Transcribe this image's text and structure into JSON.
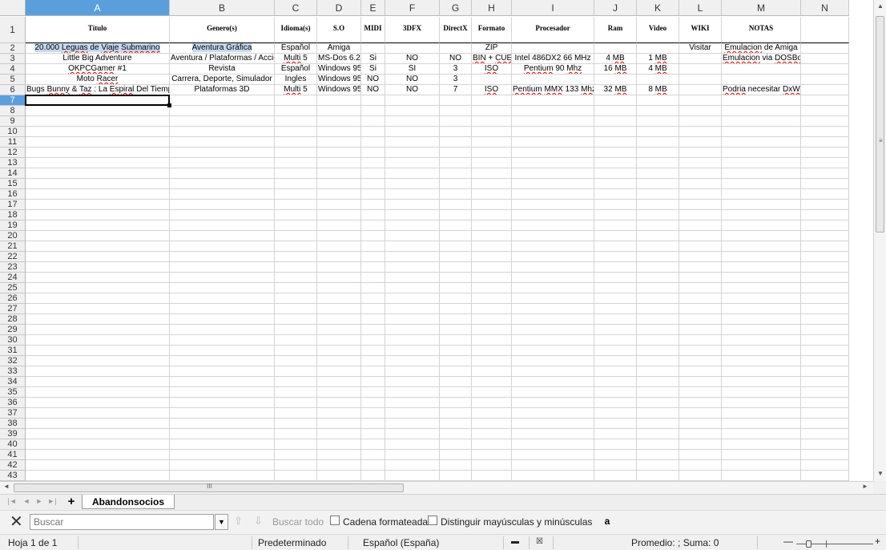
{
  "spreadsheet": {
    "columns": [
      "A",
      "B",
      "C",
      "D",
      "E",
      "F",
      "G",
      "H",
      "I",
      "J",
      "K",
      "L",
      "M",
      "N"
    ],
    "selected_column": "A",
    "selected_row": "7",
    "header_row": [
      "Título",
      "Genero(s)",
      "Idioma(s)",
      "S.O",
      "MIDI",
      "3DFX",
      "DirectX",
      "Formato",
      "Procesador",
      "Ram",
      "Video",
      "WIKI",
      "NOTAS",
      ""
    ],
    "rows": [
      [
        "20.000 Leguas de Viaje Submarino",
        "Aventura Gráfica",
        "Español",
        "Amiga",
        "",
        "",
        "",
        "ZIP",
        "",
        "",
        "",
        "Visitar",
        "Emulacion de Amiga",
        ""
      ],
      [
        "Little Big Adventure",
        "Aventura / Plataformas / Acción",
        "Multi 5",
        "MS-Dos 6.2",
        "Si",
        "NO",
        "NO",
        "BIN + CUE",
        "Intel 486DX2 66 MHz",
        "4 MB",
        "1 MB",
        "",
        "Emulacion via DOSBox",
        ""
      ],
      [
        "OKPCGamer #1",
        "Revista",
        "Español",
        "Windows 95",
        "Si",
        "SI",
        "3",
        "ISO",
        "Pentium 90 Mhz",
        "16 MB",
        "4 MB",
        "",
        "",
        ""
      ],
      [
        "Moto Racer",
        "Carrera, Deporte, Simulador",
        "Ingles",
        "Windows 95",
        "NO",
        "NO",
        "3",
        "",
        "",
        "",
        "",
        "",
        "",
        ""
      ],
      [
        "Bugs Bunny & Taz : La Espiral Del Tiempo",
        "Plataformas 3D",
        "Multi 5",
        "Windows 95",
        "NO",
        "NO",
        "7",
        "ISO",
        "Pentium MMX 133 Mhz",
        "32 MB",
        "8 MB",
        "",
        "Podria necesitar DxWnd",
        ""
      ]
    ],
    "row_numbers": [
      "1",
      "2",
      "3",
      "4",
      "5",
      "6",
      "7",
      "8",
      "9",
      "10",
      "11",
      "12",
      "13",
      "14",
      "15",
      "16",
      "17",
      "18",
      "19",
      "20",
      "21",
      "22",
      "23",
      "24",
      "25",
      "26",
      "27",
      "28",
      "29",
      "30",
      "31",
      "32",
      "33",
      "34",
      "35",
      "36",
      "37",
      "38",
      "39",
      "40",
      "41",
      "42",
      "43"
    ]
  },
  "scroll": {
    "grip": "≡",
    "hgrip": "III"
  },
  "sheets": {
    "add": "+",
    "active": "Abandonsocios"
  },
  "find": {
    "placeholder": "Buscar",
    "find_all": "Buscar todo",
    "formatted": "Cadena formateada",
    "match_case": "Distinguir mayúsculas y minúsculas",
    "close": "✕",
    "dropdown": "▼",
    "up": "⇧",
    "down": "⇩",
    "icon": "a"
  },
  "status": {
    "sheet": "Hoja 1 de 1",
    "style": "Predeterminado",
    "language": "Español (España)",
    "sum": "Promedio: ; Suma: 0",
    "zoom_minus": "—",
    "zoom_plus": "+"
  },
  "colors": {
    "selection": "#5a9fdc",
    "highlight": "#c6d9f1",
    "spell": "#d00000"
  }
}
